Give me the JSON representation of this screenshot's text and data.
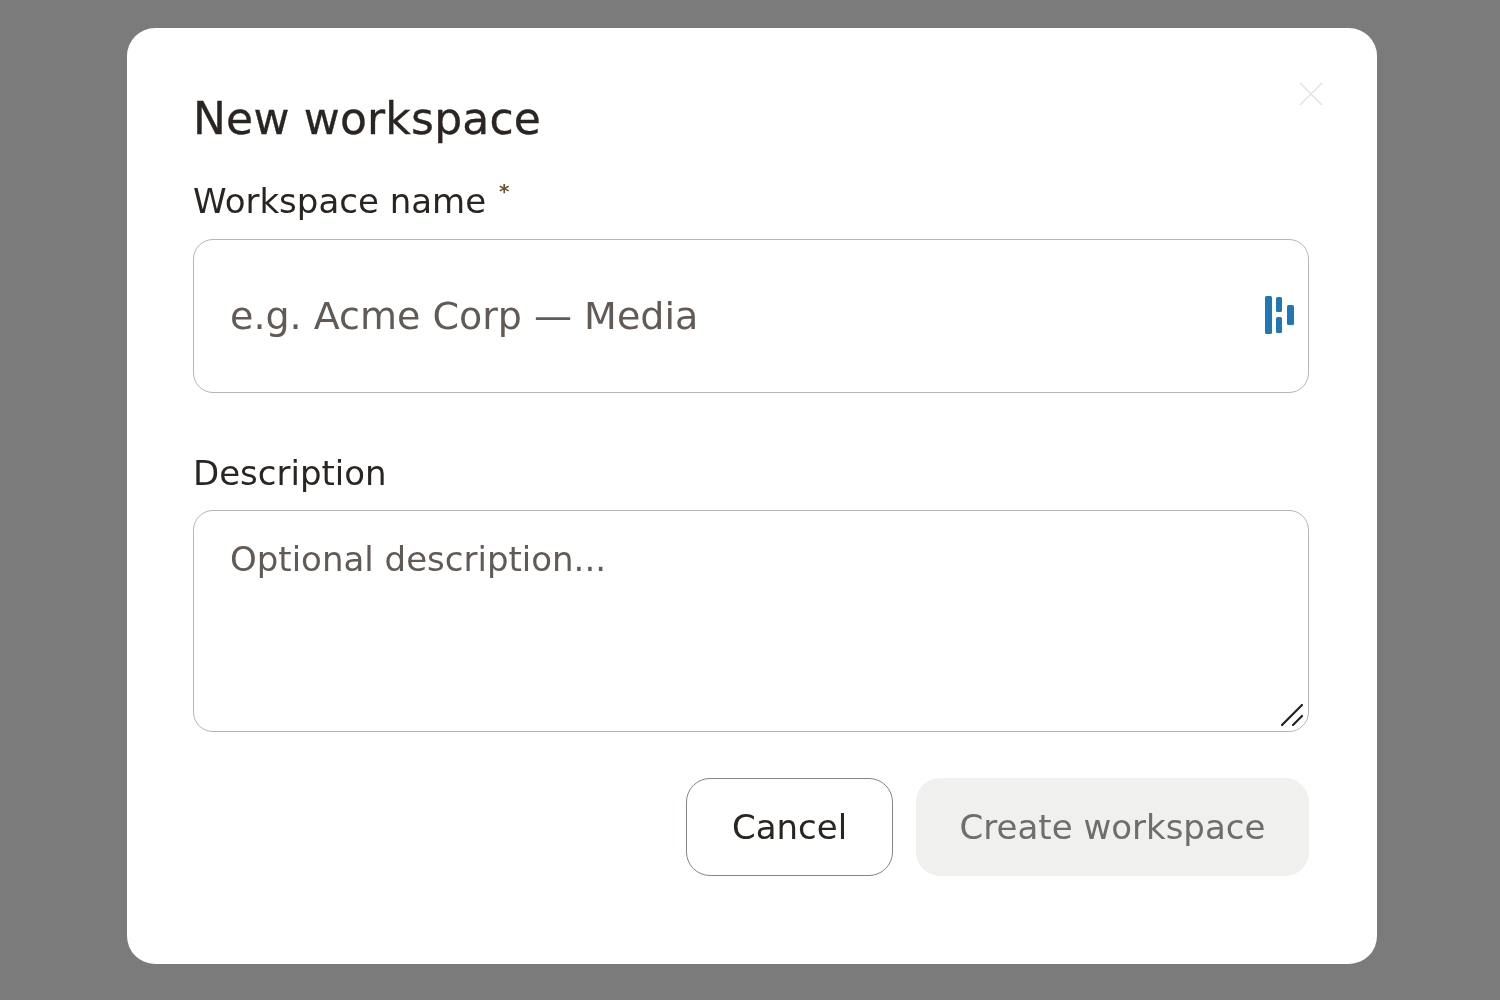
{
  "dialog": {
    "title": "New workspace",
    "fields": [
      {
        "kind": "text",
        "label": "Workspace name",
        "required_mark": "*",
        "placeholder": "e.g. Acme Corp — Media"
      },
      {
        "kind": "textarea",
        "label": "Description",
        "placeholder": "Optional description..."
      }
    ],
    "buttons": [
      {
        "label": "Cancel",
        "kind": "secondary",
        "disabled": false
      },
      {
        "label": "Create workspace",
        "kind": "primary",
        "disabled": true
      }
    ]
  }
}
